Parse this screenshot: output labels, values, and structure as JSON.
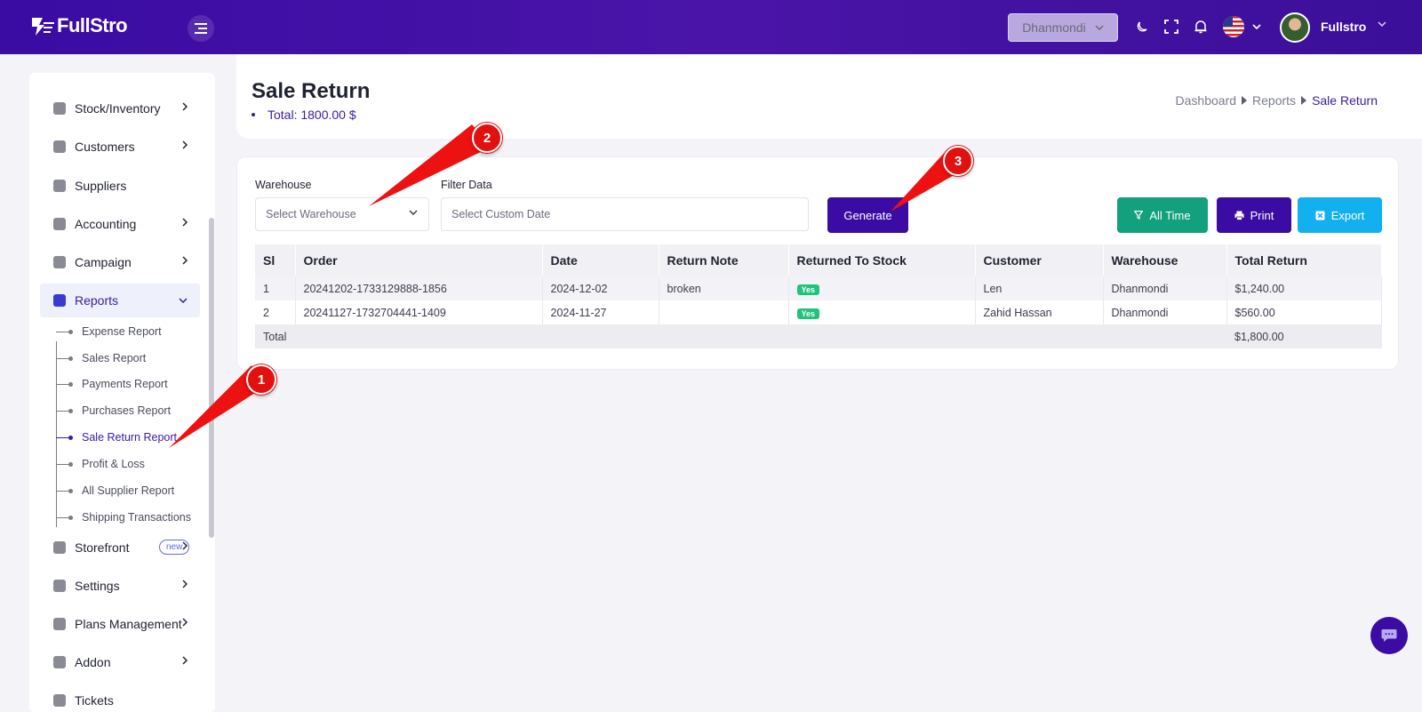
{
  "app": {
    "name": "FullStro",
    "logo_text": "FullStro"
  },
  "topbar": {
    "branch": "Dhanmondi",
    "icons": [
      "moon-icon",
      "fullscreen-icon",
      "bell-icon",
      "us-flag-icon"
    ],
    "username": "Fullstro"
  },
  "sidebar": {
    "items": [
      {
        "label": "Stock/Inventory",
        "icon": "box-icon",
        "has_chevron": true
      },
      {
        "label": "Customers",
        "icon": "users-icon",
        "has_chevron": true
      },
      {
        "label": "Suppliers",
        "icon": "supplier-icon",
        "has_chevron": false
      },
      {
        "label": "Accounting",
        "icon": "ledger-icon",
        "has_chevron": true
      },
      {
        "label": "Campaign",
        "icon": "campaign-icon",
        "has_chevron": true
      },
      {
        "label": "Reports",
        "icon": "report-icon",
        "has_chevron": true,
        "active": true
      },
      {
        "label": "Storefront",
        "icon": "gear-icon",
        "has_chevron": true,
        "badge": "new"
      },
      {
        "label": "Settings",
        "icon": "gear-icon",
        "has_chevron": true
      },
      {
        "label": "Plans Management",
        "icon": "user-plan-icon",
        "has_chevron": true
      },
      {
        "label": "Addon",
        "icon": "puzzle-icon",
        "has_chevron": true
      },
      {
        "label": "Tickets",
        "icon": "ticket-icon",
        "has_chevron": false
      }
    ],
    "report_sub_items": [
      {
        "label": "Expense Report"
      },
      {
        "label": "Sales Report"
      },
      {
        "label": "Payments Report"
      },
      {
        "label": "Purchases Report"
      },
      {
        "label": "Sale Return Report",
        "active": true
      },
      {
        "label": "Profit & Loss"
      },
      {
        "label": "All Supplier Report"
      },
      {
        "label": "Shipping Transactions"
      }
    ]
  },
  "header": {
    "title": "Sale Return",
    "total": "Total: 1800.00 $",
    "breadcrumb": [
      "Dashboard",
      "Reports",
      "Sale Return"
    ]
  },
  "filters": {
    "warehouse_label": "Warehouse",
    "warehouse_placeholder": "Select Warehouse",
    "filter_label": "Filter Data",
    "date_placeholder": "Select Custom Date",
    "generate": "Generate",
    "all_time": "All Time",
    "print": "Print",
    "export": "Export"
  },
  "table": {
    "columns": [
      "Sl",
      "Order",
      "Date",
      "Return Note",
      "Returned To Stock",
      "Customer",
      "Warehouse",
      "Total Return"
    ],
    "rows": [
      {
        "sl": "1",
        "order": "20241202-1733129888-1856",
        "date": "2024-12-02",
        "note": "broken",
        "returned": "Yes",
        "customer": "Len",
        "warehouse": "Dhanmondi",
        "total": "$1,240.00"
      },
      {
        "sl": "2",
        "order": "20241127-1732704441-1409",
        "date": "2024-11-27",
        "note": "",
        "returned": "Yes",
        "customer": "Zahid Hassan",
        "warehouse": "Dhanmondi",
        "total": "$560.00"
      }
    ],
    "total_label": "Total",
    "total_value": "$1,800.00"
  },
  "annotations": [
    "1",
    "2",
    "3"
  ],
  "colors": {
    "primary": "#3a0ca3",
    "success": "#13a07c",
    "info": "#13b0f0",
    "marker": "#e31010"
  }
}
